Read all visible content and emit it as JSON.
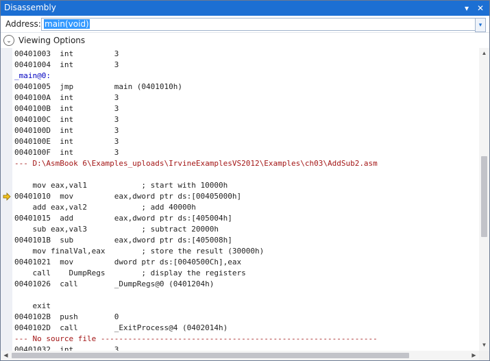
{
  "window": {
    "title": "Disassembly"
  },
  "titlebar": {
    "pin_icon": "▾",
    "close_icon": "✕"
  },
  "address": {
    "label": "Address:",
    "value": "main(void)",
    "dropdown_icon": "▾"
  },
  "viewing_options": {
    "label": "Viewing Options",
    "toggle_icon": "⌄"
  },
  "colors": {
    "titlebar": "#1c6fd3",
    "label": "#0000c0",
    "source": "#a31515",
    "selection": "#3399ff",
    "exec_arrow": "#f0c020"
  },
  "lines": [
    {
      "text": "00401003  int         3",
      "kind": "asm"
    },
    {
      "text": "00401004  int         3",
      "kind": "asm"
    },
    {
      "text": "_main@0:",
      "kind": "label"
    },
    {
      "text": "00401005  jmp         main (0401010h)",
      "kind": "asm"
    },
    {
      "text": "0040100A  int         3",
      "kind": "asm"
    },
    {
      "text": "0040100B  int         3",
      "kind": "asm"
    },
    {
      "text": "0040100C  int         3",
      "kind": "asm"
    },
    {
      "text": "0040100D  int         3",
      "kind": "asm"
    },
    {
      "text": "0040100E  int         3",
      "kind": "asm"
    },
    {
      "text": "0040100F  int         3",
      "kind": "asm"
    },
    {
      "text": "--- D:\\AsmBook 6\\Examples_uploads\\IrvineExamplesVS2012\\Examples\\ch03\\AddSub2.asm",
      "kind": "source"
    },
    {
      "text": "",
      "kind": "blank"
    },
    {
      "text": "    mov eax,val1            ; start with 10000h",
      "kind": "code"
    },
    {
      "text": "00401010  mov         eax,dword ptr ds:[00405000h]",
      "kind": "asm",
      "current": true
    },
    {
      "text": "    add eax,val2            ; add 40000h",
      "kind": "code"
    },
    {
      "text": "00401015  add         eax,dword ptr ds:[405004h]",
      "kind": "asm"
    },
    {
      "text": "    sub eax,val3            ; subtract 20000h",
      "kind": "code"
    },
    {
      "text": "0040101B  sub         eax,dword ptr ds:[405008h]",
      "kind": "asm"
    },
    {
      "text": "    mov finalVal,eax        ; store the result (30000h)",
      "kind": "code"
    },
    {
      "text": "00401021  mov         dword ptr ds:[0040500Ch],eax",
      "kind": "asm"
    },
    {
      "text": "    call    DumpRegs        ; display the registers",
      "kind": "code"
    },
    {
      "text": "00401026  call        _DumpRegs@0 (0401204h)",
      "kind": "asm"
    },
    {
      "text": "",
      "kind": "blank"
    },
    {
      "text": "    exit",
      "kind": "code"
    },
    {
      "text": "0040102B  push        0",
      "kind": "asm"
    },
    {
      "text": "0040102D  call        _ExitProcess@4 (0402014h)",
      "kind": "asm"
    },
    {
      "text": "--- No source file -------------------------------------------------------------",
      "kind": "source"
    },
    {
      "text": "00401032  int         3",
      "kind": "asm"
    }
  ],
  "scroll": {
    "up_icon": "▲",
    "down_icon": "▼",
    "left_icon": "◀",
    "right_icon": "▶"
  }
}
